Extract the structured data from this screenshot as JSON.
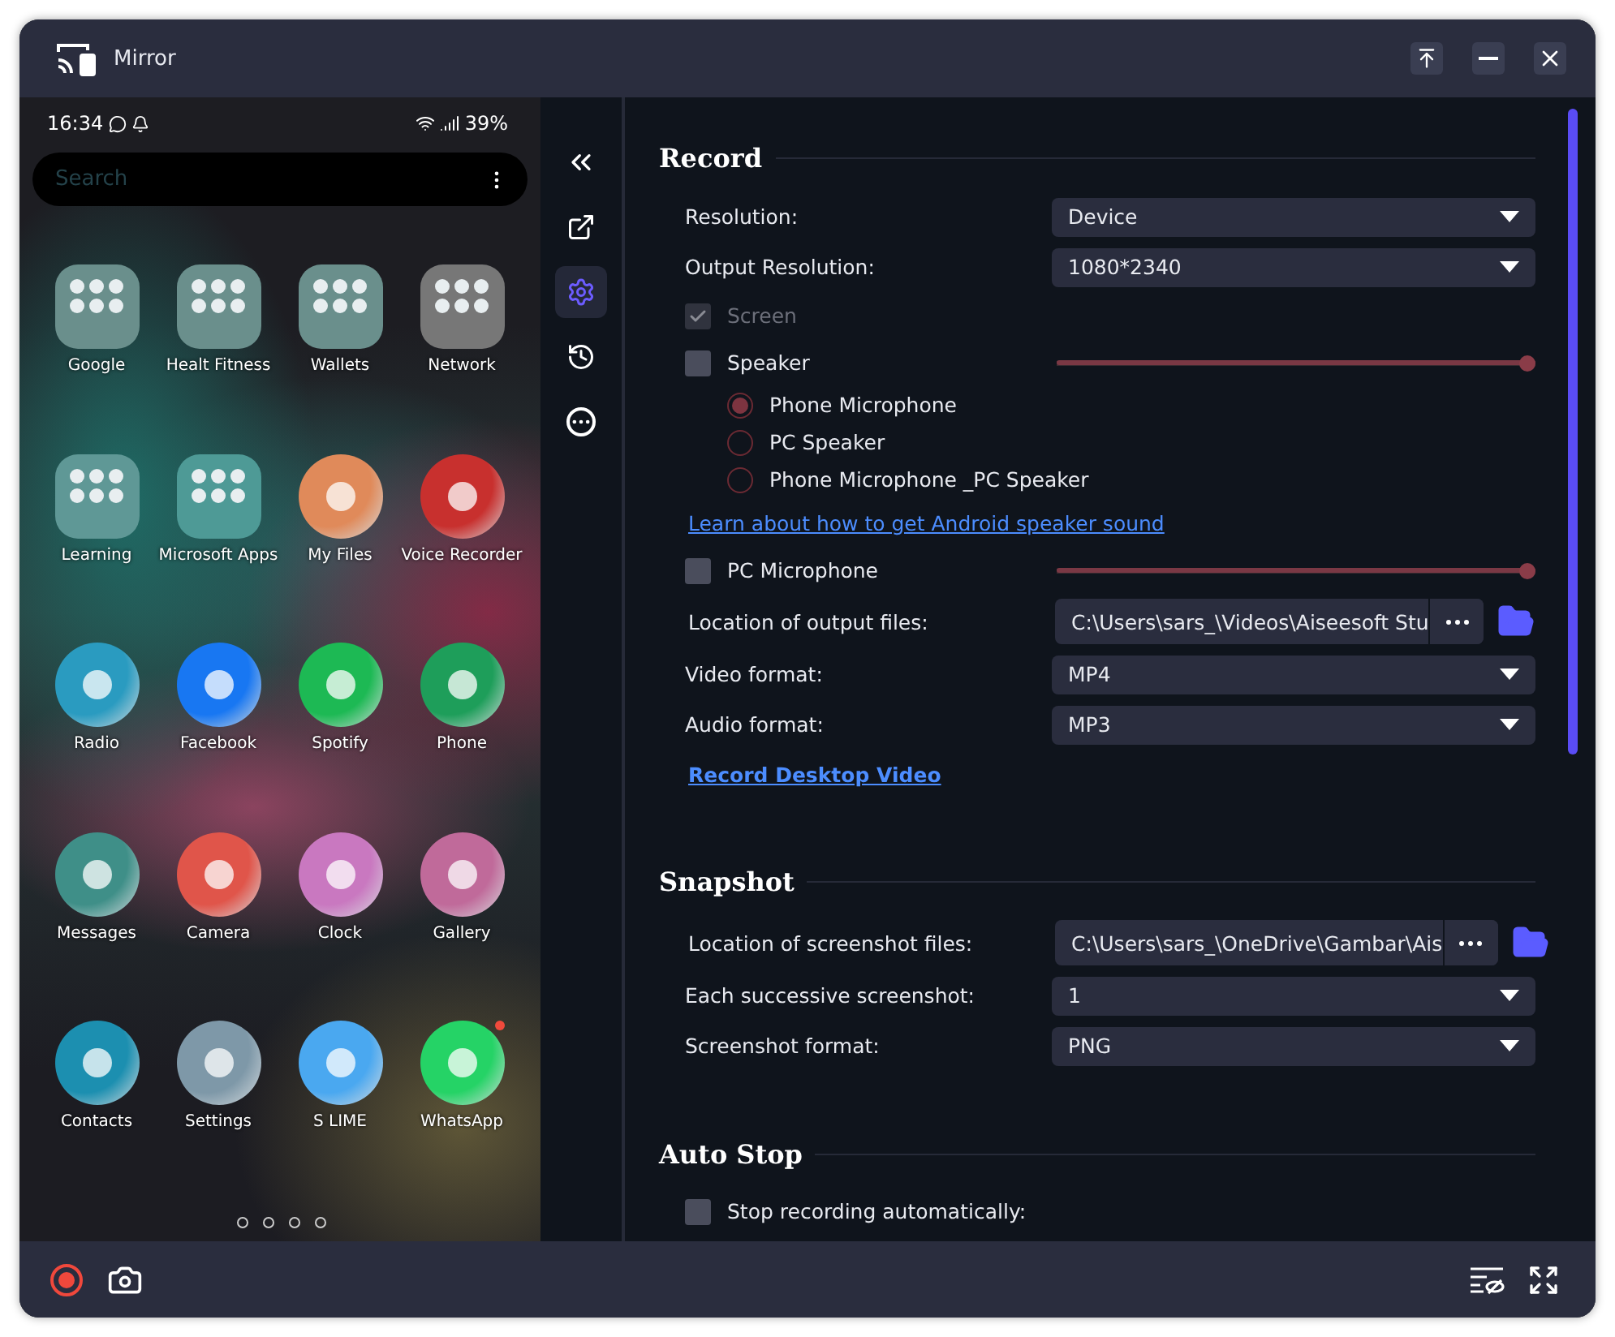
{
  "window": {
    "title": "Mirror"
  },
  "phone": {
    "time": "16:34",
    "battery": "39%",
    "search": {
      "placeholder": "Search"
    },
    "apps": [
      {
        "label": "Google",
        "kind": "folder",
        "color": "#6a8f8c",
        "notification": false
      },
      {
        "label": "Healt Fitness",
        "kind": "folder",
        "color": "#6a8f8c",
        "notification": false
      },
      {
        "label": "Wallets",
        "kind": "folder",
        "color": "#6a8f8c",
        "notification": false
      },
      {
        "label": "Network",
        "kind": "folder",
        "color": "#777777",
        "notification": false
      },
      {
        "label": "Learning",
        "kind": "folder",
        "color": "#5f9896",
        "notification": false
      },
      {
        "label": "Microsoft Apps",
        "kind": "folder",
        "color": "#4e9a96",
        "notification": false
      },
      {
        "label": "My Files",
        "kind": "app",
        "color": "#e08a5a",
        "notification": false
      },
      {
        "label": "Voice Recorder",
        "kind": "app",
        "color": "#c8302e",
        "notification": false
      },
      {
        "label": "Radio",
        "kind": "app",
        "color": "#2a9bc0",
        "notification": false
      },
      {
        "label": "Facebook",
        "kind": "app",
        "color": "#1877f2",
        "notification": false
      },
      {
        "label": "Spotify",
        "kind": "app",
        "color": "#1db954",
        "notification": false
      },
      {
        "label": "Phone",
        "kind": "app",
        "color": "#1e9e5a",
        "notification": false
      },
      {
        "label": "Messages",
        "kind": "app",
        "color": "#3f8f88",
        "notification": false
      },
      {
        "label": "Camera",
        "kind": "app",
        "color": "#e0554a",
        "notification": false
      },
      {
        "label": "Clock",
        "kind": "app",
        "color": "#c978c0",
        "notification": false
      },
      {
        "label": "Gallery",
        "kind": "app",
        "color": "#c06a9a",
        "notification": false
      },
      {
        "label": "Contacts",
        "kind": "app",
        "color": "#1c8fb0",
        "notification": false
      },
      {
        "label": "Settings",
        "kind": "app",
        "color": "#7e98a8",
        "notification": false
      },
      {
        "label": "S LIME",
        "kind": "app",
        "color": "#4aa8f0",
        "notification": false
      },
      {
        "label": "WhatsApp",
        "kind": "app",
        "color": "#25d366",
        "notification": true
      }
    ]
  },
  "nav": [
    {
      "kind": "collapse",
      "selected": false
    },
    {
      "kind": "cast",
      "selected": false
    },
    {
      "kind": "settings",
      "selected": true
    },
    {
      "kind": "history",
      "selected": false
    },
    {
      "kind": "more",
      "selected": false
    }
  ],
  "sections": [
    {
      "title": "Record",
      "items": [
        {
          "kind": "select",
          "label": "Resolution:",
          "value": "Device"
        },
        {
          "kind": "select",
          "label": "Output Resolution:",
          "value": "1080*2340"
        },
        {
          "kind": "checkbox",
          "label": "Screen",
          "checked": true,
          "disabled": true
        },
        {
          "kind": "checkbox",
          "label": "Speaker",
          "checked": false,
          "disabled": false,
          "level": 1
        },
        {
          "kind": "radio",
          "label": "Phone Microphone",
          "selected": true
        },
        {
          "kind": "radio",
          "label": "PC Speaker",
          "selected": false
        },
        {
          "kind": "radio",
          "label": "Phone Microphone _PC Speaker",
          "selected": false
        },
        {
          "kind": "link",
          "label": "Learn about how to get Android speaker sound",
          "bold": false
        },
        {
          "kind": "checkbox",
          "label": "PC Microphone",
          "checked": false,
          "disabled": false,
          "level": 1
        },
        {
          "kind": "path",
          "label": "Location of output files:",
          "value": "C:\\Users\\sars_\\Videos\\Aiseesoft Stu"
        },
        {
          "kind": "select",
          "label": "Video format:",
          "value": "MP4"
        },
        {
          "kind": "select",
          "label": "Audio format:",
          "value": "MP3"
        },
        {
          "kind": "link",
          "label": "Record Desktop Video",
          "bold": true
        }
      ]
    },
    {
      "title": "Snapshot",
      "items": [
        {
          "kind": "path",
          "label": "Location of screenshot files:",
          "value": "C:\\Users\\sars_\\OneDrive\\Gambar\\Ais"
        },
        {
          "kind": "select",
          "label": "Each successive screenshot:",
          "value": "1"
        },
        {
          "kind": "select",
          "label": "Screenshot format:",
          "value": "PNG"
        }
      ]
    },
    {
      "title": "Auto Stop",
      "items": [
        {
          "kind": "checkbox",
          "label": "Stop recording automatically:",
          "checked": false,
          "disabled": false
        }
      ]
    }
  ]
}
